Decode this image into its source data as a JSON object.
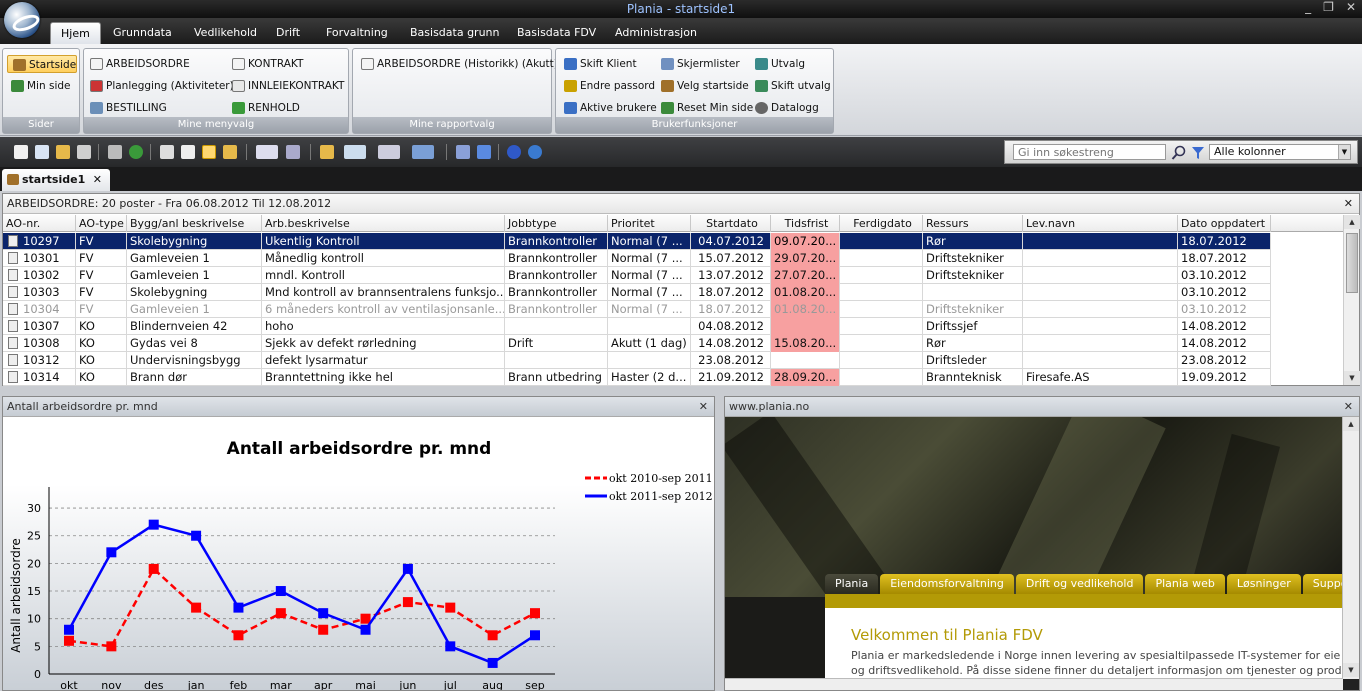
{
  "window": {
    "title": "Plania - startside1",
    "controls": [
      "_",
      "❐",
      "✕"
    ]
  },
  "ribbon_tabs": [
    "Hjem",
    "Grunndata",
    "Vedlikehold",
    "Drift",
    "Forvaltning",
    "Basisdata grunn",
    "Basisdata FDV",
    "Administrasjon"
  ],
  "groups": {
    "sider": {
      "title": "Sider",
      "items": [
        "Startside",
        "Min side"
      ]
    },
    "mine_menyvalg": {
      "title": "Mine menyvalg",
      "items": [
        "ARBEIDSORDRE",
        "Planlegging (Aktiviteter)",
        "BESTILLING",
        "KONTRAKT",
        "INNLEIEKONTRAKT",
        "RENHOLD"
      ]
    },
    "mine_rapportvalg": {
      "title": "Mine rapportvalg",
      "items": [
        "ARBEIDSORDRE (Historikk) (Akutt)"
      ]
    },
    "brukerfunksjoner": {
      "title": "Brukerfunksjoner",
      "items": [
        "Skift Klient",
        "Endre passord",
        "Aktive brukere",
        "Skjermlister",
        "Velg startside",
        "Reset Min side",
        "Utvalg",
        "Skift utvalg",
        "Datalogg"
      ]
    }
  },
  "search": {
    "placeholder": "Gi inn søkestreng",
    "column_select": "Alle kolonner"
  },
  "doc_tab": {
    "label": "startside1",
    "close": "✕"
  },
  "grid": {
    "header": "ARBEIDSORDRE: 20 poster - Fra 06.08.2012 Til 12.08.2012",
    "columns": [
      "AO-nr.",
      "AO-type",
      "Bygg/anl beskrivelse",
      "Arb.beskrivelse",
      "Jobbtype",
      "Prioritet",
      "Startdato",
      "Tidsfrist",
      "Ferdigdato",
      "Ressurs",
      "Lev.navn",
      "Dato oppdatert"
    ],
    "rows": [
      [
        "10297",
        "FV",
        "Skolebygning",
        "Ukentlig Kontroll",
        "Brannkontroller",
        "Normal (7 ...",
        "04.07.2012",
        "09.07.20...",
        "",
        "Rør",
        "",
        "18.07.2012"
      ],
      [
        "10301",
        "FV",
        "Gamleveien 1",
        "Månedlig kontroll",
        "Brannkontroller",
        "Normal (7 ...",
        "15.07.2012",
        "29.07.20...",
        "",
        "Driftstekniker",
        "",
        "18.07.2012"
      ],
      [
        "10302",
        "FV",
        "Gamleveien 1",
        "mndl. Kontroll",
        "Brannkontroller",
        "Normal (7 ...",
        "13.07.2012",
        "27.07.20...",
        "",
        "Driftstekniker",
        "",
        "03.10.2012"
      ],
      [
        "10303",
        "FV",
        "Skolebygning",
        "Mnd kontroll av brannsentralens funksjo...",
        "Brannkontroller",
        "Normal (7 ...",
        "18.07.2012",
        "01.08.20...",
        "",
        "",
        "",
        "03.10.2012"
      ],
      [
        "10304",
        "FV",
        "Gamleveien 1",
        "6 måneders kontroll av ventilasjonsanle...",
        "Brannkontroller",
        "Normal (7 ...",
        "18.07.2012",
        "01.08.20...",
        "",
        "Driftstekniker",
        "",
        "03.10.2012"
      ],
      [
        "10307",
        "KO",
        "Blindernveien 42",
        "hoho",
        "",
        "",
        "04.08.2012",
        "",
        "",
        "Driftssjef",
        "",
        "14.08.2012"
      ],
      [
        "10308",
        "KO",
        "Gydas vei 8",
        "Sjekk av defekt rørledning",
        "Drift",
        "Akutt (1 dag)",
        "14.08.2012",
        "15.08.20...",
        "",
        "Rør",
        "",
        "14.08.2012"
      ],
      [
        "10312",
        "KO",
        "Undervisningsbygg",
        "defekt lysarmatur",
        "",
        "",
        "23.08.2012",
        "",
        "",
        "Driftsleder",
        "",
        "23.08.2012"
      ],
      [
        "10314",
        "KO",
        "Brann dør",
        "Branntettning ikke hel",
        "Brann utbedring",
        "Haster (2 d...",
        "21.09.2012",
        "28.09.20...",
        "",
        "Brannteknisk",
        "Firesafe.AS",
        "19.09.2012"
      ]
    ]
  },
  "chart_panel": {
    "header": "Antall arbeidsordre pr. mnd",
    "close": "✕"
  },
  "chart_data": {
    "type": "line",
    "title": "Antall arbeidsordre pr. mnd",
    "ylabel": "Antall arbeidsordre",
    "xlabel": "",
    "categories": [
      "okt",
      "nov",
      "des",
      "jan",
      "feb",
      "mar",
      "apr",
      "mai",
      "jun",
      "jul",
      "aug",
      "sep"
    ],
    "yticks": [
      "0",
      "5",
      "10",
      "15",
      "20",
      "25",
      "30"
    ],
    "ylim": [
      0,
      32
    ],
    "legend_position": "top-right",
    "grid": true,
    "series": [
      {
        "name": "okt 2010-sep 2011",
        "color": "#ff0000",
        "dashed": true,
        "values": [
          6,
          5,
          19,
          12,
          7,
          11,
          8,
          10,
          13,
          12,
          7,
          11
        ]
      },
      {
        "name": "okt 2011-sep 2012",
        "color": "#0000ff",
        "dashed": false,
        "values": [
          8,
          22,
          27,
          25,
          12,
          15,
          11,
          8,
          19,
          5,
          2,
          7
        ]
      }
    ]
  },
  "web_panel": {
    "header": "www.plania.no",
    "close": "✕",
    "tabs": [
      "Plania",
      "Eiendomsforvaltning",
      "Drift og vedlikehold",
      "Plania web",
      "Løsninger",
      "Support"
    ],
    "title": "Velkommen til Plania FDV",
    "text1": "Plania er markedsledende i Norge innen levering av spesialtilpassede IT-systemer for eie",
    "text2": "og driftsvedlikehold. På disse sidene finner du detaljert informasjon om tjenester og produ"
  }
}
